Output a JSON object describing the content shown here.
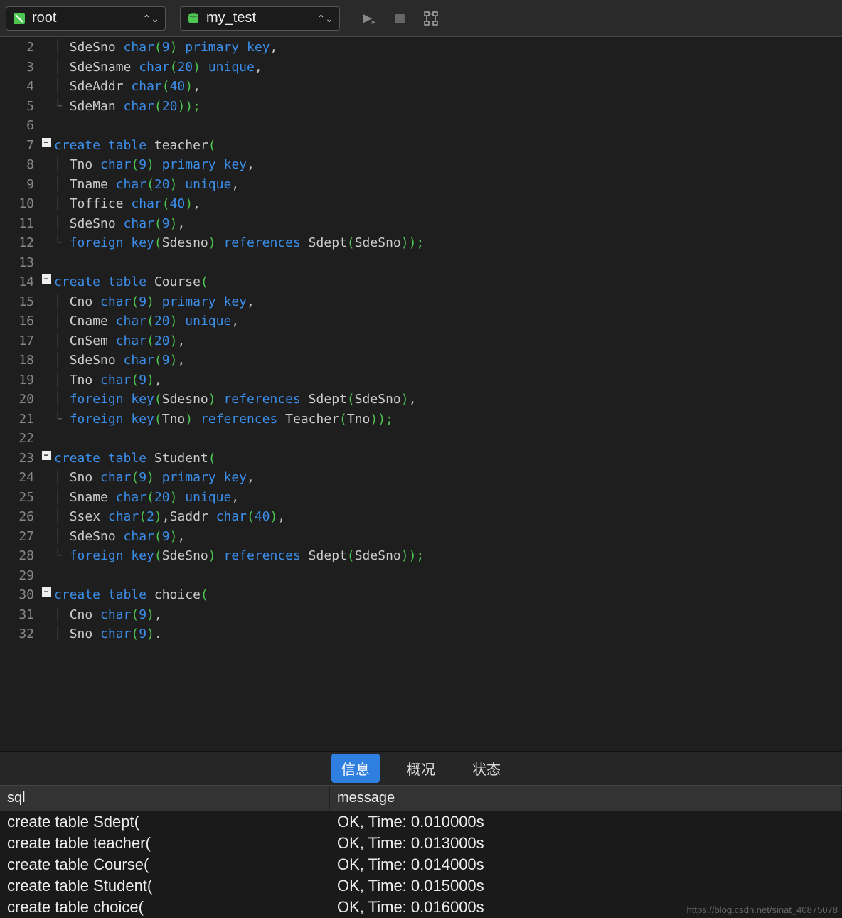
{
  "toolbar": {
    "connection": "root",
    "database": "my_test"
  },
  "code_lines": [
    {
      "n": 2,
      "fold": "",
      "guide": "│ ",
      "tokens": [
        [
          "txt",
          "SdeSno "
        ],
        [
          "kw",
          "char"
        ],
        [
          "br",
          "("
        ],
        [
          "kw",
          "9"
        ],
        [
          "br",
          ")"
        ],
        [
          "txt",
          " "
        ],
        [
          "kw",
          "primary key"
        ],
        [
          "txt",
          ","
        ]
      ]
    },
    {
      "n": 3,
      "fold": "",
      "guide": "│ ",
      "tokens": [
        [
          "txt",
          "SdeSname "
        ],
        [
          "kw",
          "char"
        ],
        [
          "br",
          "("
        ],
        [
          "kw",
          "20"
        ],
        [
          "br",
          ")"
        ],
        [
          "txt",
          " "
        ],
        [
          "kw",
          "unique"
        ],
        [
          "txt",
          ","
        ]
      ]
    },
    {
      "n": 4,
      "fold": "",
      "guide": "│ ",
      "tokens": [
        [
          "txt",
          "SdeAddr "
        ],
        [
          "kw",
          "char"
        ],
        [
          "br",
          "("
        ],
        [
          "kw",
          "40"
        ],
        [
          "br",
          ")"
        ],
        [
          "txt",
          ","
        ]
      ]
    },
    {
      "n": 5,
      "fold": "",
      "guide": "└ ",
      "tokens": [
        [
          "txt",
          "SdeMan "
        ],
        [
          "kw",
          "char"
        ],
        [
          "br",
          "("
        ],
        [
          "kw",
          "20"
        ],
        [
          "br",
          "));"
        ]
      ]
    },
    {
      "n": 6,
      "fold": "",
      "guide": "  ",
      "tokens": []
    },
    {
      "n": 7,
      "fold": "-",
      "guide": "",
      "tokens": [
        [
          "kw",
          "create table"
        ],
        [
          "txt",
          " teacher"
        ],
        [
          "br",
          "("
        ]
      ]
    },
    {
      "n": 8,
      "fold": "",
      "guide": "│ ",
      "tokens": [
        [
          "txt",
          "Tno "
        ],
        [
          "kw",
          "char"
        ],
        [
          "br",
          "("
        ],
        [
          "kw",
          "9"
        ],
        [
          "br",
          ")"
        ],
        [
          "txt",
          " "
        ],
        [
          "kw",
          "primary key"
        ],
        [
          "txt",
          ","
        ]
      ]
    },
    {
      "n": 9,
      "fold": "",
      "guide": "│ ",
      "tokens": [
        [
          "txt",
          "Tname "
        ],
        [
          "kw",
          "char"
        ],
        [
          "br",
          "("
        ],
        [
          "kw",
          "20"
        ],
        [
          "br",
          ")"
        ],
        [
          "txt",
          " "
        ],
        [
          "kw",
          "unique"
        ],
        [
          "txt",
          ","
        ]
      ]
    },
    {
      "n": 10,
      "fold": "",
      "guide": "│ ",
      "tokens": [
        [
          "txt",
          "Toffice "
        ],
        [
          "kw",
          "char"
        ],
        [
          "br",
          "("
        ],
        [
          "kw",
          "40"
        ],
        [
          "br",
          ")"
        ],
        [
          "txt",
          ","
        ]
      ]
    },
    {
      "n": 11,
      "fold": "",
      "guide": "│ ",
      "tokens": [
        [
          "txt",
          "SdeSno "
        ],
        [
          "kw",
          "char"
        ],
        [
          "br",
          "("
        ],
        [
          "kw",
          "9"
        ],
        [
          "br",
          ")"
        ],
        [
          "txt",
          ","
        ]
      ]
    },
    {
      "n": 12,
      "fold": "",
      "guide": "└ ",
      "tokens": [
        [
          "kw",
          "foreign key"
        ],
        [
          "br",
          "("
        ],
        [
          "txt",
          "Sdesno"
        ],
        [
          "br",
          ")"
        ],
        [
          "txt",
          " "
        ],
        [
          "kw",
          "references"
        ],
        [
          "txt",
          " Sdept"
        ],
        [
          "br",
          "("
        ],
        [
          "txt",
          "SdeSno"
        ],
        [
          "br",
          "));"
        ]
      ]
    },
    {
      "n": 13,
      "fold": "",
      "guide": "  ",
      "tokens": []
    },
    {
      "n": 14,
      "fold": "-",
      "guide": "",
      "tokens": [
        [
          "kw",
          "create table"
        ],
        [
          "txt",
          " Course"
        ],
        [
          "br",
          "("
        ]
      ]
    },
    {
      "n": 15,
      "fold": "",
      "guide": "│ ",
      "tokens": [
        [
          "txt",
          "Cno "
        ],
        [
          "kw",
          "char"
        ],
        [
          "br",
          "("
        ],
        [
          "kw",
          "9"
        ],
        [
          "br",
          ")"
        ],
        [
          "txt",
          " "
        ],
        [
          "kw",
          "primary key"
        ],
        [
          "txt",
          ","
        ]
      ]
    },
    {
      "n": 16,
      "fold": "",
      "guide": "│ ",
      "tokens": [
        [
          "txt",
          "Cname "
        ],
        [
          "kw",
          "char"
        ],
        [
          "br",
          "("
        ],
        [
          "kw",
          "20"
        ],
        [
          "br",
          ")"
        ],
        [
          "txt",
          " "
        ],
        [
          "kw",
          "unique"
        ],
        [
          "txt",
          ","
        ]
      ]
    },
    {
      "n": 17,
      "fold": "",
      "guide": "│ ",
      "tokens": [
        [
          "txt",
          "CnSem "
        ],
        [
          "kw",
          "char"
        ],
        [
          "br",
          "("
        ],
        [
          "kw",
          "20"
        ],
        [
          "br",
          ")"
        ],
        [
          "txt",
          ","
        ]
      ]
    },
    {
      "n": 18,
      "fold": "",
      "guide": "│ ",
      "tokens": [
        [
          "txt",
          "SdeSno "
        ],
        [
          "kw",
          "char"
        ],
        [
          "br",
          "("
        ],
        [
          "kw",
          "9"
        ],
        [
          "br",
          ")"
        ],
        [
          "txt",
          ","
        ]
      ]
    },
    {
      "n": 19,
      "fold": "",
      "guide": "│ ",
      "tokens": [
        [
          "txt",
          "Tno "
        ],
        [
          "kw",
          "char"
        ],
        [
          "br",
          "("
        ],
        [
          "kw",
          "9"
        ],
        [
          "br",
          ")"
        ],
        [
          "txt",
          ","
        ]
      ]
    },
    {
      "n": 20,
      "fold": "",
      "guide": "│ ",
      "tokens": [
        [
          "kw",
          "foreign key"
        ],
        [
          "br",
          "("
        ],
        [
          "txt",
          "Sdesno"
        ],
        [
          "br",
          ")"
        ],
        [
          "txt",
          " "
        ],
        [
          "kw",
          "references"
        ],
        [
          "txt",
          " Sdept"
        ],
        [
          "br",
          "("
        ],
        [
          "txt",
          "SdeSno"
        ],
        [
          "br",
          ")"
        ],
        [
          "txt",
          ","
        ]
      ]
    },
    {
      "n": 21,
      "fold": "",
      "guide": "└ ",
      "tokens": [
        [
          "kw",
          "foreign key"
        ],
        [
          "br",
          "("
        ],
        [
          "txt",
          "Tno"
        ],
        [
          "br",
          ")"
        ],
        [
          "txt",
          " "
        ],
        [
          "kw",
          "references"
        ],
        [
          "txt",
          " Teacher"
        ],
        [
          "br",
          "("
        ],
        [
          "txt",
          "Tno"
        ],
        [
          "br",
          "));"
        ]
      ]
    },
    {
      "n": 22,
      "fold": "",
      "guide": "  ",
      "tokens": []
    },
    {
      "n": 23,
      "fold": "-",
      "guide": "",
      "tokens": [
        [
          "kw",
          "create table"
        ],
        [
          "txt",
          " Student"
        ],
        [
          "br",
          "("
        ]
      ]
    },
    {
      "n": 24,
      "fold": "",
      "guide": "│ ",
      "tokens": [
        [
          "txt",
          "Sno "
        ],
        [
          "kw",
          "char"
        ],
        [
          "br",
          "("
        ],
        [
          "kw",
          "9"
        ],
        [
          "br",
          ")"
        ],
        [
          "txt",
          " "
        ],
        [
          "kw",
          "primary key"
        ],
        [
          "txt",
          ","
        ]
      ]
    },
    {
      "n": 25,
      "fold": "",
      "guide": "│ ",
      "tokens": [
        [
          "txt",
          "Sname "
        ],
        [
          "kw",
          "char"
        ],
        [
          "br",
          "("
        ],
        [
          "kw",
          "20"
        ],
        [
          "br",
          ")"
        ],
        [
          "txt",
          " "
        ],
        [
          "kw",
          "unique"
        ],
        [
          "txt",
          ","
        ]
      ]
    },
    {
      "n": 26,
      "fold": "",
      "guide": "│ ",
      "tokens": [
        [
          "txt",
          "Ssex "
        ],
        [
          "kw",
          "char"
        ],
        [
          "br",
          "("
        ],
        [
          "kw",
          "2"
        ],
        [
          "br",
          ")"
        ],
        [
          "txt",
          ",Saddr "
        ],
        [
          "kw",
          "char"
        ],
        [
          "br",
          "("
        ],
        [
          "kw",
          "40"
        ],
        [
          "br",
          ")"
        ],
        [
          "txt",
          ","
        ]
      ]
    },
    {
      "n": 27,
      "fold": "",
      "guide": "│ ",
      "tokens": [
        [
          "txt",
          "SdeSno "
        ],
        [
          "kw",
          "char"
        ],
        [
          "br",
          "("
        ],
        [
          "kw",
          "9"
        ],
        [
          "br",
          ")"
        ],
        [
          "txt",
          ","
        ]
      ]
    },
    {
      "n": 28,
      "fold": "",
      "guide": "└ ",
      "tokens": [
        [
          "kw",
          "foreign key"
        ],
        [
          "br",
          "("
        ],
        [
          "txt",
          "SdeSno"
        ],
        [
          "br",
          ")"
        ],
        [
          "txt",
          " "
        ],
        [
          "kw",
          "references"
        ],
        [
          "txt",
          " Sdept"
        ],
        [
          "br",
          "("
        ],
        [
          "txt",
          "SdeSno"
        ],
        [
          "br",
          "));"
        ]
      ]
    },
    {
      "n": 29,
      "fold": "",
      "guide": "  ",
      "tokens": []
    },
    {
      "n": 30,
      "fold": "-",
      "guide": "",
      "tokens": [
        [
          "kw",
          "create table"
        ],
        [
          "txt",
          " choice"
        ],
        [
          "br",
          "("
        ]
      ]
    },
    {
      "n": 31,
      "fold": "",
      "guide": "│ ",
      "tokens": [
        [
          "txt",
          "Cno "
        ],
        [
          "kw",
          "char"
        ],
        [
          "br",
          "("
        ],
        [
          "kw",
          "9"
        ],
        [
          "br",
          ")"
        ],
        [
          "txt",
          ","
        ]
      ]
    },
    {
      "n": 32,
      "fold": "",
      "guide": "│ ",
      "tokens": [
        [
          "txt",
          "Sno "
        ],
        [
          "kw",
          "char"
        ],
        [
          "br",
          "("
        ],
        [
          "kw",
          "9"
        ],
        [
          "br",
          ")"
        ],
        [
          "txt",
          "."
        ]
      ]
    }
  ],
  "tabs": {
    "info": "信息",
    "overview": "概况",
    "status": "状态"
  },
  "results": {
    "headers": {
      "sql": "sql",
      "message": "message"
    },
    "rows": [
      {
        "sql": "create table Sdept(",
        "message": "OK, Time: 0.010000s"
      },
      {
        "sql": "create table teacher(",
        "message": "OK, Time: 0.013000s"
      },
      {
        "sql": "create table Course(",
        "message": "OK, Time: 0.014000s"
      },
      {
        "sql": "create table Student(",
        "message": "OK, Time: 0.015000s"
      },
      {
        "sql": "create table choice(",
        "message": "OK, Time: 0.016000s"
      }
    ]
  },
  "watermark": "https://blog.csdn.net/sinat_40875078"
}
